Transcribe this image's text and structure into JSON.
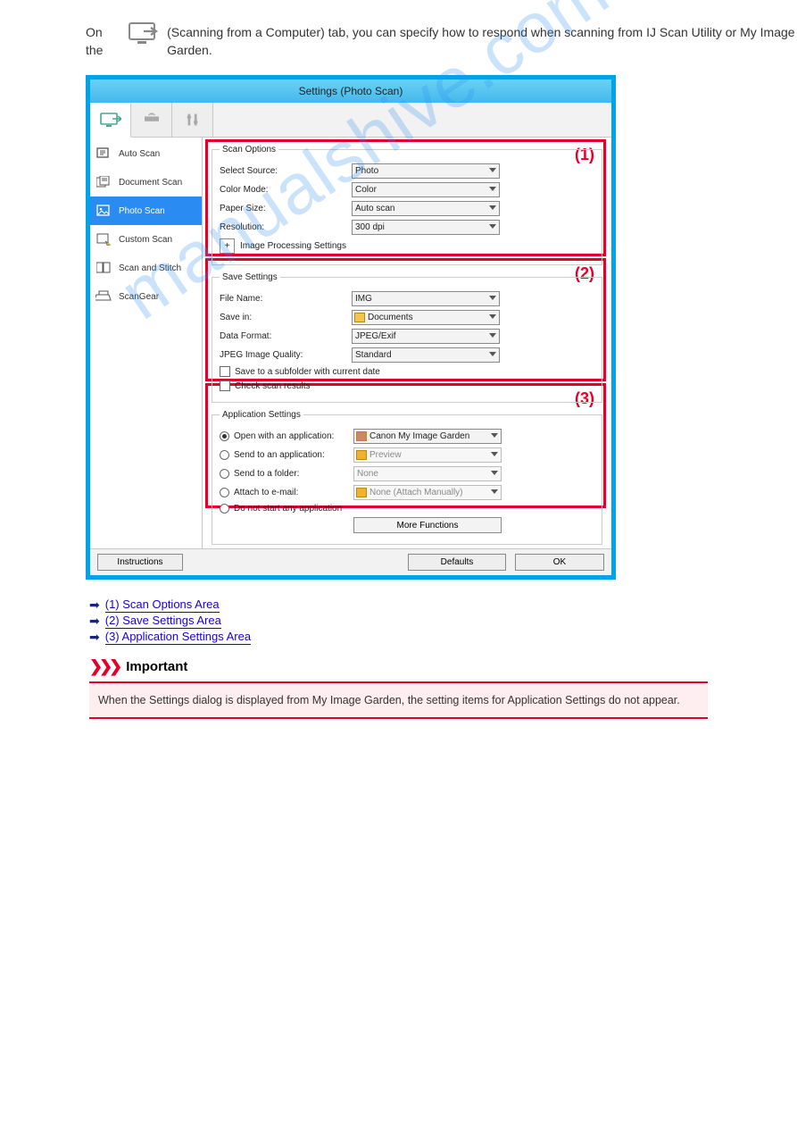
{
  "intro": {
    "prefix": "On the",
    "suffix": "(Scanning from a Computer) tab, you can specify how to respond when scanning from IJ Scan Utility or My Image Garden."
  },
  "dialog": {
    "title": "Settings (Photo Scan)",
    "sidebar": [
      {
        "label": "Auto Scan"
      },
      {
        "label": "Document Scan"
      },
      {
        "label": "Photo Scan"
      },
      {
        "label": "Custom Scan"
      },
      {
        "label": "Scan and Stitch"
      },
      {
        "label": "ScanGear"
      }
    ],
    "markers": {
      "m1": "(1)",
      "m2": "(2)",
      "m3": "(3)"
    },
    "scan_options": {
      "legend": "Scan Options",
      "select_source_label": "Select Source:",
      "select_source_value": "Photo",
      "color_mode_label": "Color Mode:",
      "color_mode_value": "Color",
      "paper_size_label": "Paper Size:",
      "paper_size_value": "Auto scan",
      "resolution_label": "Resolution:",
      "resolution_value": "300 dpi",
      "ips_label": "Image Processing Settings",
      "plus": "+"
    },
    "save_settings": {
      "legend": "Save Settings",
      "file_name_label": "File Name:",
      "file_name_value": "IMG",
      "save_in_label": "Save in:",
      "save_in_value": "Documents",
      "data_format_label": "Data Format:",
      "data_format_value": "JPEG/Exif",
      "jpeg_quality_label": "JPEG Image Quality:",
      "jpeg_quality_value": "Standard",
      "chk1": "Save to a subfolder with current date",
      "chk2": "Check scan results"
    },
    "app_settings": {
      "legend": "Application Settings",
      "open_label": "Open with an application:",
      "open_value": "Canon My Image Garden",
      "send_app_label": "Send to an application:",
      "send_app_value": "Preview",
      "send_folder_label": "Send to a folder:",
      "send_folder_value": "None",
      "email_label": "Attach to e-mail:",
      "email_value": "None (Attach Manually)",
      "noapp_label": "Do not start any application",
      "more_functions": "More Functions"
    },
    "footer": {
      "instructions": "Instructions",
      "defaults": "Defaults",
      "ok": "OK"
    }
  },
  "links": {
    "l1": "(1) Scan Options Area",
    "l2": "(2) Save Settings Area",
    "l3": "(3) Application Settings Area"
  },
  "important": {
    "title": "Important",
    "note": "When the Settings dialog is displayed from My Image Garden, the setting items for Application Settings do not appear."
  },
  "watermark": "manualshive.com"
}
